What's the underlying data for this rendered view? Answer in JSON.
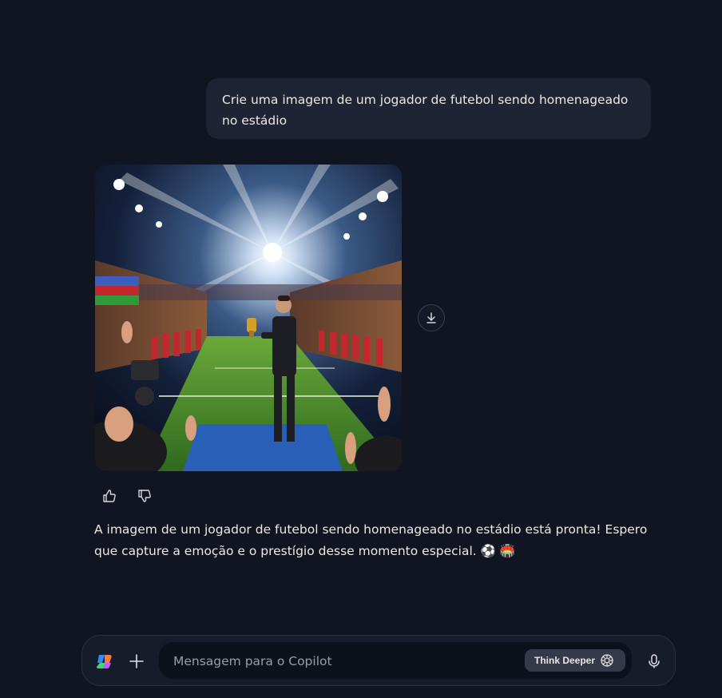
{
  "conversation": {
    "user_message": "Crie uma imagem de um jogador de futebol sendo homenageado no estádio",
    "assistant_message": "A imagem de um jogador de futebol sendo homenageado no estádio está pronta! Espero que capture a emoção e o prestígio desse momento especial. ⚽ 🏟️"
  },
  "image_actions": {
    "download_icon": "download-icon"
  },
  "feedback": {
    "like_icon": "thumbs-up-icon",
    "dislike_icon": "thumbs-down-icon"
  },
  "composer": {
    "placeholder": "Mensagem para o Copilot",
    "think_deeper_label": "Think Deeper",
    "logo_icon": "copilot-logo-icon",
    "add_icon": "plus-icon",
    "mic_icon": "microphone-icon"
  },
  "colors": {
    "background": "#101521",
    "user_bubble": "#1f2435",
    "composer": "#171c2b",
    "think_button": "#353a4a"
  }
}
